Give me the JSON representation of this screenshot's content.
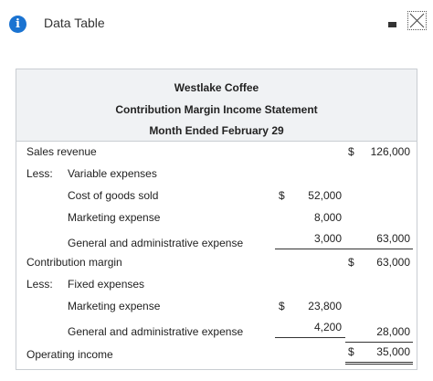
{
  "window": {
    "title": "Data Table",
    "info_icon": "info-icon",
    "minimize_icon": "minimize-icon",
    "close_icon": "close-icon"
  },
  "statement": {
    "company": "Westlake Coffee",
    "report": "Contribution Margin Income Statement",
    "period": "Month Ended February 29"
  },
  "rows": {
    "sales": {
      "label": "Sales revenue",
      "currency": "$",
      "total": "126,000"
    },
    "less_variable": {
      "prefix": "Less:",
      "label": "Variable expenses"
    },
    "cogs": {
      "label": "Cost of goods sold",
      "currency": "$",
      "amount": "52,000"
    },
    "marketing_var": {
      "label": "Marketing expense",
      "amount": "8,000"
    },
    "ga_var": {
      "label": "General and administrative expense",
      "amount": "3,000",
      "total": "63,000"
    },
    "contribution": {
      "label": "Contribution margin",
      "currency": "$",
      "total": "63,000"
    },
    "less_fixed": {
      "prefix": "Less:",
      "label": "Fixed expenses"
    },
    "marketing_fixed": {
      "label": "Marketing expense",
      "currency": "$",
      "amount": "23,800"
    },
    "ga_fixed": {
      "label": "General and administrative expense",
      "amount": "4,200",
      "total": "28,000"
    },
    "operating": {
      "label": "Operating income",
      "currency": "$",
      "total": "35,000"
    }
  }
}
